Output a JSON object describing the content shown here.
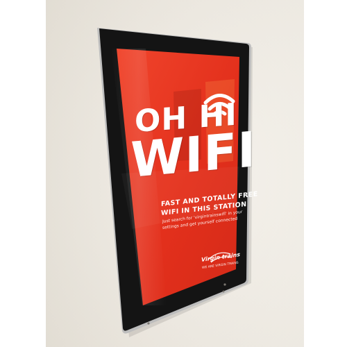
{
  "sign": {
    "headline_1": "OH HI",
    "headline_2": "WIFI",
    "sub_line_1": "FAST AND TOTALLY FREE",
    "sub_line_2": "WIFI IN THIS STATION",
    "body_line_1": "Just search for 'virgintrainswifi' in your",
    "body_line_2": "settings and get yourself connected",
    "brand": "Virgin trains",
    "tagline": "WE ARE VIRGIN TRAINS"
  },
  "colors": {
    "screen_red": "#e8321e",
    "bezel": "#141414",
    "wall": "#ece7de"
  },
  "icons": [
    "wifi-icon",
    "virgin-trains-logo"
  ]
}
